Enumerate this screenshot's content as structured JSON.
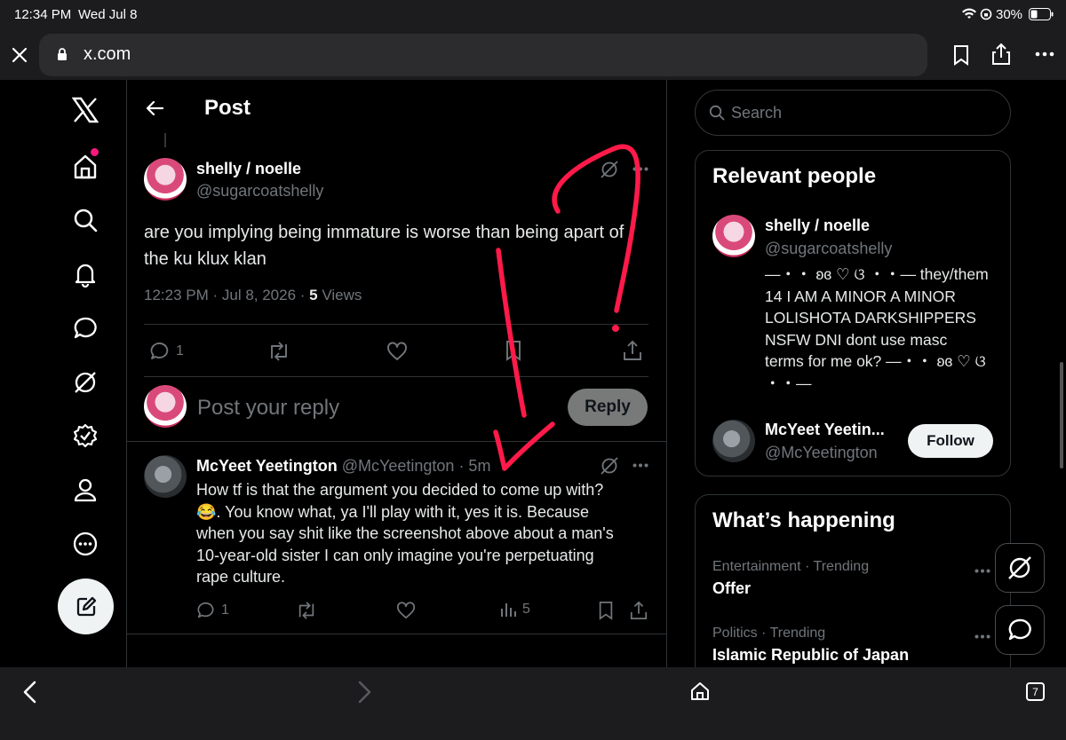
{
  "status": {
    "time": "12:34 PM",
    "date": "Wed Jul 8",
    "battery": "30%"
  },
  "browser": {
    "url": "x.com",
    "tab_count": "7"
  },
  "header": {
    "title": "Post"
  },
  "post": {
    "author_name": "shelly / noelle",
    "author_handle": "@sugarcoatshelly",
    "text_line1": "are you implying being immature is worse than being apart of",
    "text_line2": "the ku klux klan",
    "timestamp": "12:23 PM · Jul 8, 2026 · ",
    "views_count": "5",
    "views_label": " Views",
    "reply_count": "1"
  },
  "reply_box": {
    "placeholder": "Post your reply",
    "button": "Reply"
  },
  "reply": {
    "author_name": "McYeet Yeetington",
    "author_handle": "@McYeetington",
    "time": "· 5m",
    "text_lines": [
      "How tf is that the argument you decided to come up with?",
      "😂. You know what, ya I'll play with it, yes it is. Because",
      "when you say shit like the screenshot above about a man's",
      "10-year-old sister I can only imagine you're perpetuating",
      "rape culture."
    ],
    "reply_count": "1",
    "views": "5"
  },
  "sidebar": {
    "search_placeholder": "Search",
    "relevant_title": "Relevant people",
    "person1": {
      "name": "shelly / noelle",
      "handle": "@sugarcoatshelly",
      "bio_lines": [
        "—・・ ʚɞ ♡ ଓ ・・— they/them",
        "14 I AM A MINOR A MINOR",
        "LOLISHOTA DARKSHIPPERS",
        "NSFW DNI dont use masc",
        "terms for me ok? —・・ ʚɞ ♡ ଓ",
        "・・—"
      ]
    },
    "person2": {
      "name": "McYeet Yeetin...",
      "handle": "@McYeetington",
      "follow": "Follow"
    },
    "happening_title": "What’s happening",
    "trends": [
      {
        "category": "Entertainment · Trending",
        "name": "Offer"
      },
      {
        "category": "Politics · Trending",
        "name": "Islamic Republic of Japan"
      }
    ]
  },
  "colors": {
    "annotation": "#ff1a4a",
    "like_pink": "#f91880",
    "accent": "#1d9bf0"
  }
}
